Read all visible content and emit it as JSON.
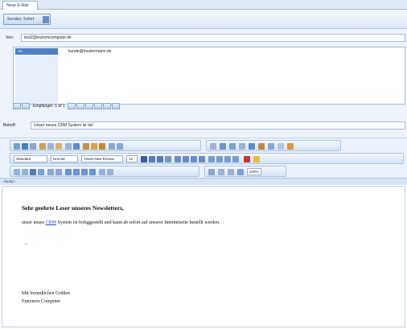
{
  "tab": {
    "label": "Neue E-Mail"
  },
  "toolbar": {
    "send_label": "Senden: Sofort"
  },
  "header": {
    "from_label": "Von:",
    "from_value": "test2@eunomcomputer.de",
    "to_type": "An:",
    "to_value": "kunde@mustermann.de",
    "pager_text": "Empfänger: 1 of 1",
    "subject_label": "Betreff:",
    "subject_value": "Unser neues CRM System ist da!"
  },
  "format": {
    "style": "Standard",
    "paragraph": "Normal",
    "font": "Times New Roman",
    "size": "12",
    "zoom": "100%"
  },
  "status": {
    "body_tag": "<body>"
  },
  "message": {
    "greeting": "Sehr geehrte Leser unseres Newsletters,",
    "p1_before": "unser neues ",
    "p1_link": "CRM",
    "p1_after": " System ist fertiggestellt und kann ab sofort auf unserer Internetseite bestellt werden.",
    "dash": "--",
    "closing1": "Mit freundlichen Grüßen",
    "closing2": "Eunomos Computer"
  },
  "colors": {
    "accent": "#4f7fc4",
    "link": "#1f4fbf",
    "panel": "#eef3fa"
  }
}
